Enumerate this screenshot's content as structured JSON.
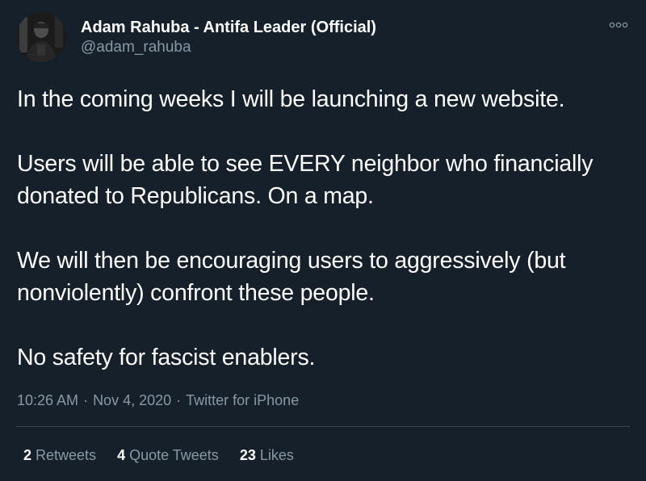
{
  "author": {
    "display_name": "Adam Rahuba - Antifa Leader (Official)",
    "handle": "@adam_rahuba"
  },
  "tweet": {
    "paragraphs": [
      "In the coming weeks I will be launching a new website.",
      "Users will be able to see EVERY neighbor who financially donated to Republicans. On a map.",
      "We will then be encouraging users to aggressively (but nonviolently) confront these people.",
      "No safety for fascist enablers."
    ],
    "time": "10:26 AM",
    "date": "Nov 4, 2020",
    "source": "Twitter for iPhone",
    "separator": "·"
  },
  "stats": {
    "retweets_count": "2",
    "retweets_label": "Retweets",
    "quotes_count": "4",
    "quotes_label": "Quote Tweets",
    "likes_count": "23",
    "likes_label": "Likes"
  },
  "icons": {
    "more": "more-options-icon",
    "avatar": "user-avatar"
  },
  "colors": {
    "background": "#15202b",
    "text_primary": "#ffffff",
    "text_secondary": "#8899a6",
    "divider": "#38444d"
  }
}
